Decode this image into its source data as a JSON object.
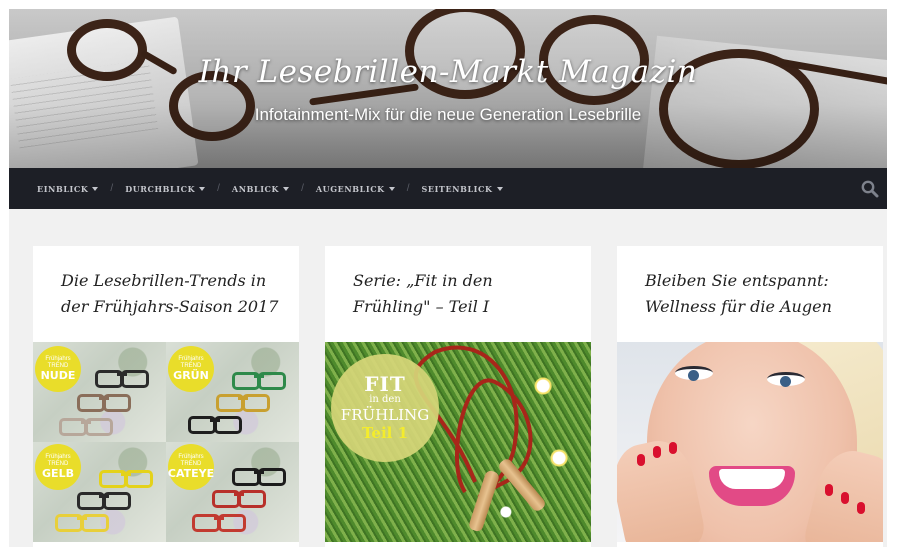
{
  "header": {
    "title": "Ihr Lesebrillen-Markt Magazin",
    "tagline": "Infotainment-Mix für die neue Generation Lesebrille"
  },
  "nav": {
    "items": [
      {
        "label": "EINBLICK"
      },
      {
        "label": "DURCHBLICK"
      },
      {
        "label": "ANBLICK"
      },
      {
        "label": "AUGENBLICK"
      },
      {
        "label": "SEITENBLICK"
      }
    ],
    "separator": "/",
    "search_icon": "search-icon"
  },
  "cards": [
    {
      "title": "Die Lesebrillen-Trends in der Frühjahrs-Saison 2017",
      "badges": [
        {
          "small1": "Frühjahrs",
          "small2": "TREND",
          "big": "NUDE"
        },
        {
          "small1": "Frühjahrs",
          "small2": "TREND",
          "big": "GRÜN"
        },
        {
          "small1": "Frühjahrs",
          "small2": "TREND",
          "big": "GELB"
        },
        {
          "small1": "Frühjahrs",
          "small2": "TREND",
          "big": "CATEYE"
        }
      ]
    },
    {
      "title": "Serie: „Fit in den Frühling\" – Teil I",
      "badge": {
        "line1": "FIT",
        "line2": "in den",
        "line3": "FRÜHLING",
        "line4": "Teil 1"
      }
    },
    {
      "title": "Bleiben Sie entspannt: Wellness für die Augen"
    }
  ],
  "colors": {
    "nav_bg": "#1d1f26",
    "page_bg": "#f1f1f1",
    "badge_yellow": "#e9dd2a"
  }
}
